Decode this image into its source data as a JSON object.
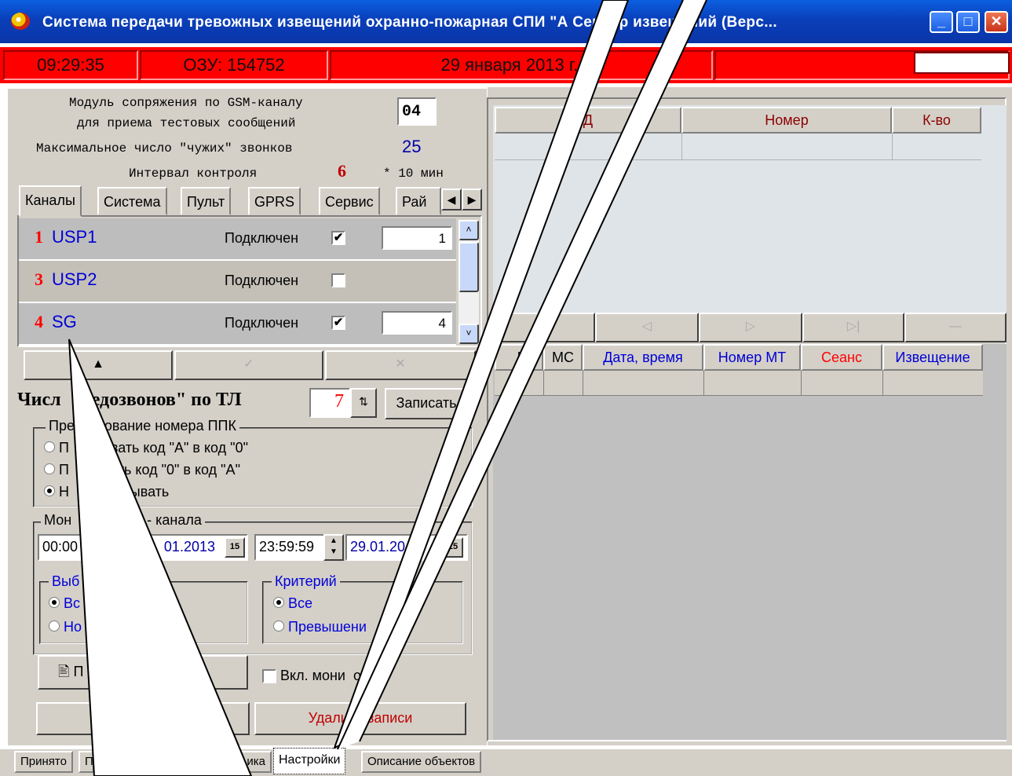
{
  "window": {
    "title": "Система передачи тревожных извещений охранно-пожарная СПИ \"А                Сервер извещений (Верс...",
    "minimize_glyph": "_",
    "maximize_glyph": "□",
    "close_glyph": "✕"
  },
  "status": {
    "time": "09:29:35",
    "ram": "ОЗУ: 154752",
    "date": "29 января 2013 г.,Вт"
  },
  "settings": {
    "gsm_module_label_1": "Модуль сопряжения по GSM-каналу",
    "gsm_module_label_2": "для приема тестовых сообщений",
    "gsm_module_value": "04",
    "max_calls_label": "Максимальное число \"чужих\" звонков",
    "max_calls_value": "25",
    "interval_label": "Интервал контроля",
    "interval_value": "6",
    "interval_unit": "* 10 мин"
  },
  "tabs": [
    {
      "label": "Каналы"
    },
    {
      "label": "Система"
    },
    {
      "label": "Пульт"
    },
    {
      "label": "GPRS"
    },
    {
      "label": "Сервис"
    },
    {
      "label": "Рай"
    }
  ],
  "tab_scroll": {
    "left": "◀",
    "right": "▶"
  },
  "channels": [
    {
      "num": "1",
      "name": "USP1",
      "status_label": "Подключен",
      "checked": "✔",
      "value": "1"
    },
    {
      "num": "3",
      "name": "USP2",
      "status_label": "Подключен",
      "checked": "",
      "value": ""
    },
    {
      "num": "4",
      "name": "SG",
      "status_label": "Подключен",
      "checked": "✔",
      "value": "4"
    }
  ],
  "nav_buttons": {
    "up": "▲",
    "edit": "✓",
    "delete": "✕"
  },
  "redial": {
    "label": "Числ  \"недозвонов\" по ТЛ",
    "value": "7",
    "save_label": "Записать"
  },
  "ppk_group": {
    "title": "Пре  разование номера ППК",
    "options": [
      {
        "label": "П   разовать код \"А\" в код \"0\""
      },
      {
        "label": "П   азовать код \"0\" в код \"А\""
      },
      {
        "label": "Н    бразовывать"
      }
    ]
  },
  "monitoring_group": {
    "title": "Мон          GSM - канала",
    "time_from": "00:00",
    "date_from": "01.2013",
    "time_to": "23:59:59",
    "date_to": "29.01.20",
    "calendar_glyph": "15"
  },
  "selection_group": {
    "title": "Выб",
    "options": [
      {
        "label": "Вс"
      },
      {
        "label": "Но"
      }
    ]
  },
  "criteria_group": {
    "title": "Критерий",
    "options": [
      {
        "label": "Все"
      },
      {
        "label": "Превышени"
      }
    ]
  },
  "actions": {
    "request_label": "П          са",
    "monitoring_label": "Вкл. мони  оринг",
    "delete_label": "Удали  ь записи",
    "left_bottom_label": "У"
  },
  "top_grid": {
    "columns": [
      "Д",
      "Номер",
      "К-во"
    ]
  },
  "navigator": [
    "|◁",
    "◁",
    "▷",
    "▷|",
    "—"
  ],
  "bottom_grid": {
    "columns": [
      "І",
      "МС",
      "Дата, время",
      "Номер МТ",
      "Сеанс",
      "Извещение"
    ]
  },
  "bottom_tabs": [
    {
      "label": "Принято"
    },
    {
      "label": "П"
    },
    {
      "label": "ика"
    },
    {
      "label": "Настройки"
    },
    {
      "label": "Описание объектов"
    }
  ],
  "colors": {
    "title_bar": "#0a3fb9",
    "status_bar": "#ff0000",
    "panel": "#d4d0c8",
    "channel_num": "#ff0000",
    "channel_name": "#0000d8"
  }
}
